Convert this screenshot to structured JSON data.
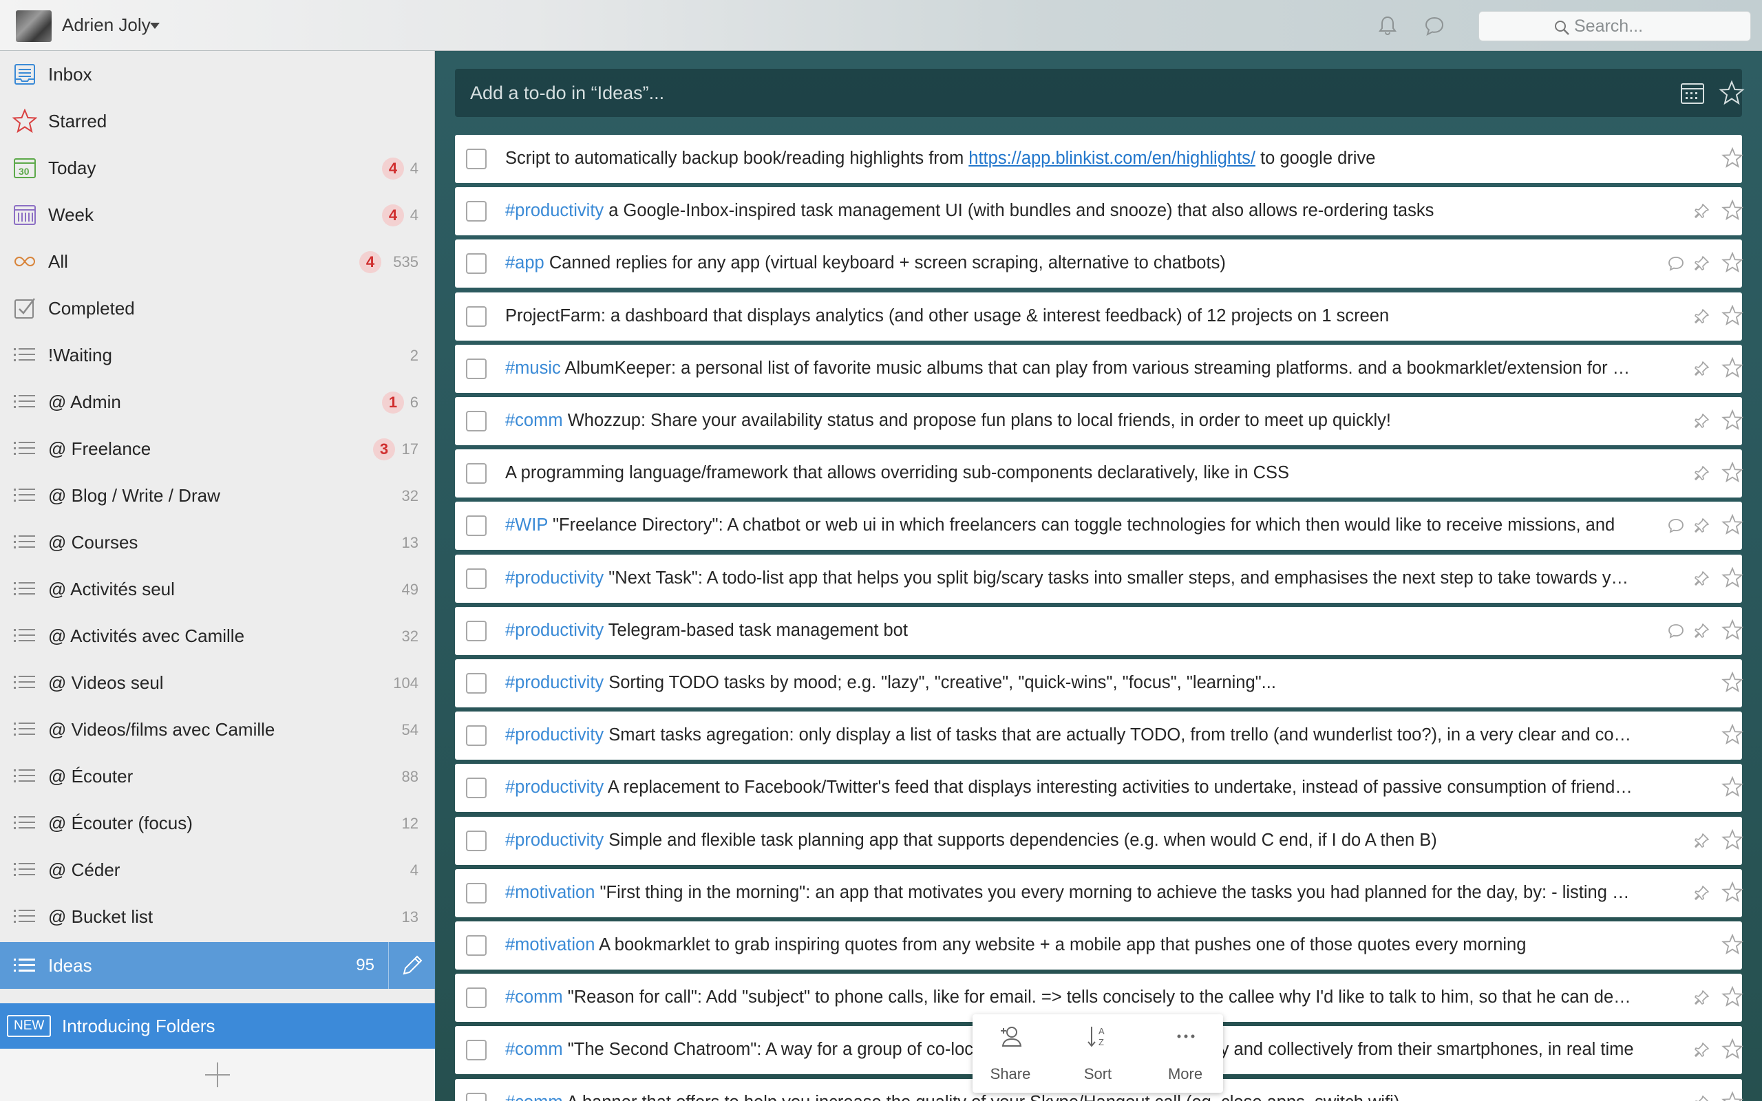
{
  "header": {
    "user_name": "Adrien Joly",
    "search_placeholder": "Search..."
  },
  "sidebar": {
    "items": [
      {
        "label": "Inbox",
        "icon": "inbox-icon",
        "badge": "",
        "count": ""
      },
      {
        "label": "Starred",
        "icon": "star-icon",
        "badge": "",
        "count": ""
      },
      {
        "label": "Today",
        "icon": "calendar-today-icon",
        "badge": "4",
        "count": "4"
      },
      {
        "label": "Week",
        "icon": "calendar-week-icon",
        "badge": "4",
        "count": "4"
      },
      {
        "label": "All",
        "icon": "infinity-icon",
        "badge": "4",
        "count": "535"
      },
      {
        "label": "Completed",
        "icon": "completed-check-icon",
        "badge": "",
        "count": ""
      },
      {
        "label": "!Waiting",
        "icon": "list-icon",
        "badge": "",
        "count": "2"
      },
      {
        "label": "@ Admin",
        "icon": "list-icon",
        "badge": "1",
        "count": "6"
      },
      {
        "label": "@ Freelance",
        "icon": "list-icon",
        "badge": "3",
        "count": "17"
      },
      {
        "label": "@ Blog / Write / Draw",
        "icon": "list-icon",
        "badge": "",
        "count": "32"
      },
      {
        "label": "@ Courses",
        "icon": "list-icon",
        "badge": "",
        "count": "13"
      },
      {
        "label": "@ Activités seul",
        "icon": "list-icon",
        "badge": "",
        "count": "49"
      },
      {
        "label": "@ Activités avec Camille",
        "icon": "list-icon",
        "badge": "",
        "count": "32"
      },
      {
        "label": "@ Videos seul",
        "icon": "list-icon",
        "badge": "",
        "count": "104"
      },
      {
        "label": "@ Videos/films avec Camille",
        "icon": "list-icon",
        "badge": "",
        "count": "54"
      },
      {
        "label": "@ Écouter",
        "icon": "list-icon",
        "badge": "",
        "count": "88"
      },
      {
        "label": "@ Écouter (focus)",
        "icon": "list-icon",
        "badge": "",
        "count": "12"
      },
      {
        "label": "@ Céder",
        "icon": "list-icon",
        "badge": "",
        "count": "4"
      },
      {
        "label": "@ Bucket list",
        "icon": "list-icon",
        "badge": "",
        "count": "13"
      }
    ],
    "active": {
      "label": "Ideas",
      "count": "95"
    },
    "banner": {
      "tag": "NEW",
      "text": "Introducing Folders"
    }
  },
  "main": {
    "add_placeholder": "Add a to-do in “Ideas”...",
    "tasks": [
      {
        "tag": "",
        "pre": "Script to automatically backup book/reading highlights from ",
        "link": "https://app.blinkist.com/en/highlights/",
        "post": " to google drive",
        "comment": false,
        "pin": false
      },
      {
        "tag": "#productivity",
        "pre": " a Google-Inbox-inspired task management UI (with bundles and snooze) that also allows re-ordering tasks",
        "link": "",
        "post": "",
        "comment": false,
        "pin": true
      },
      {
        "tag": "#app",
        "pre": " Canned replies for any app (virtual keyboard + screen scraping, alternative to chatbots)",
        "link": "",
        "post": "",
        "comment": true,
        "pin": true
      },
      {
        "tag": "",
        "pre": "ProjectFarm: a dashboard that displays analytics (and other usage & interest feedback) of 12 projects on 1 screen",
        "link": "",
        "post": "",
        "comment": false,
        "pin": true
      },
      {
        "tag": "#music",
        "pre": " AlbumKeeper: a personal list of favorite music albums that can play from various streaming platforms. and a bookmarklet/extension for quick add",
        "link": "",
        "post": "",
        "comment": false,
        "pin": true
      },
      {
        "tag": "#comm",
        "pre": " Whozzup: Share your availability status and propose fun plans to local friends, in order to meet up quickly!",
        "link": "",
        "post": "",
        "comment": false,
        "pin": true
      },
      {
        "tag": "",
        "pre": "A programming language/framework that allows overriding sub-components declaratively, like in CSS",
        "link": "",
        "post": "",
        "comment": false,
        "pin": true
      },
      {
        "tag": "#WIP",
        "pre": " \"Freelance Directory\": A chatbot or web ui in which freelancers can toggle technologies for which then would like to receive missions, and",
        "link": "",
        "post": "",
        "comment": true,
        "pin": true
      },
      {
        "tag": "#productivity",
        "pre": " \"Next Task\": A todo-list app that helps you split big/scary tasks into smaller steps, and emphasises the next step to take towards your goal",
        "link": "",
        "post": "",
        "comment": false,
        "pin": true
      },
      {
        "tag": "#productivity",
        "pre": " Telegram-based task management bot",
        "link": "",
        "post": "",
        "comment": true,
        "pin": true
      },
      {
        "tag": "#productivity",
        "pre": " Sorting TODO tasks by mood; e.g. \"lazy\", \"creative\", \"quick-wins\", \"focus\", \"learning\"...",
        "link": "",
        "post": "",
        "comment": false,
        "pin": false
      },
      {
        "tag": "#productivity",
        "pre": " Smart tasks agregation: only display a list of tasks that are actually TODO, from trello (and wunderlist too?), in a very clear and concise way",
        "link": "",
        "post": "",
        "comment": false,
        "pin": false
      },
      {
        "tag": "#productivity",
        "pre": " A replacement to Facebook/Twitter's feed that displays interesting activities to undertake, instead of passive consumption of friends'  updates",
        "link": "",
        "post": "",
        "comment": false,
        "pin": false
      },
      {
        "tag": "#productivity",
        "pre": " Simple and flexible task planning app that supports dependencies (e.g. when would C end, if I do A then B)",
        "link": "",
        "post": "",
        "comment": false,
        "pin": true
      },
      {
        "tag": "#motivation",
        "pre": " \"First thing in the morning\": an app that motivates you every morning to achieve the tasks you had planned for the day, by: - listing them",
        "link": "",
        "post": "",
        "comment": false,
        "pin": true
      },
      {
        "tag": "#motivation",
        "pre": " A bookmarklet to grab inspiring quotes from any website + a mobile app that pushes one of those quotes every morning",
        "link": "",
        "post": "",
        "comment": false,
        "pin": false
      },
      {
        "tag": "#comm",
        "pre": " \"Reason for call\": Add \"subject\" to phone calls, like for email. => tells concisely to the callee why I'd like to talk to him, so that he can decide",
        "link": "",
        "post": "",
        "comment": false,
        "pin": true
      },
      {
        "tag": "#comm",
        "pre": " \"The Second Chatroom\": A way for a group of co-located people to take notes quickly and collectively from their smartphones, in real time",
        "link": "",
        "post": "",
        "comment": false,
        "pin": true
      },
      {
        "tag": "#comm",
        "pre": " A banner that offers to help you increase the quality of your Skype/Hangout call (eg. close apps, switch wifi)",
        "link": "",
        "post": "",
        "comment": false,
        "pin": true
      }
    ]
  },
  "toolbar": {
    "share": "Share",
    "sort": "Sort",
    "more": "More"
  },
  "colors": {
    "accent": "#5a9ad8",
    "tag": "#3a8ad6",
    "badge_bg": "#f3d1d1",
    "badge_text": "#d02e2e",
    "banner": "#3c8ad9"
  }
}
